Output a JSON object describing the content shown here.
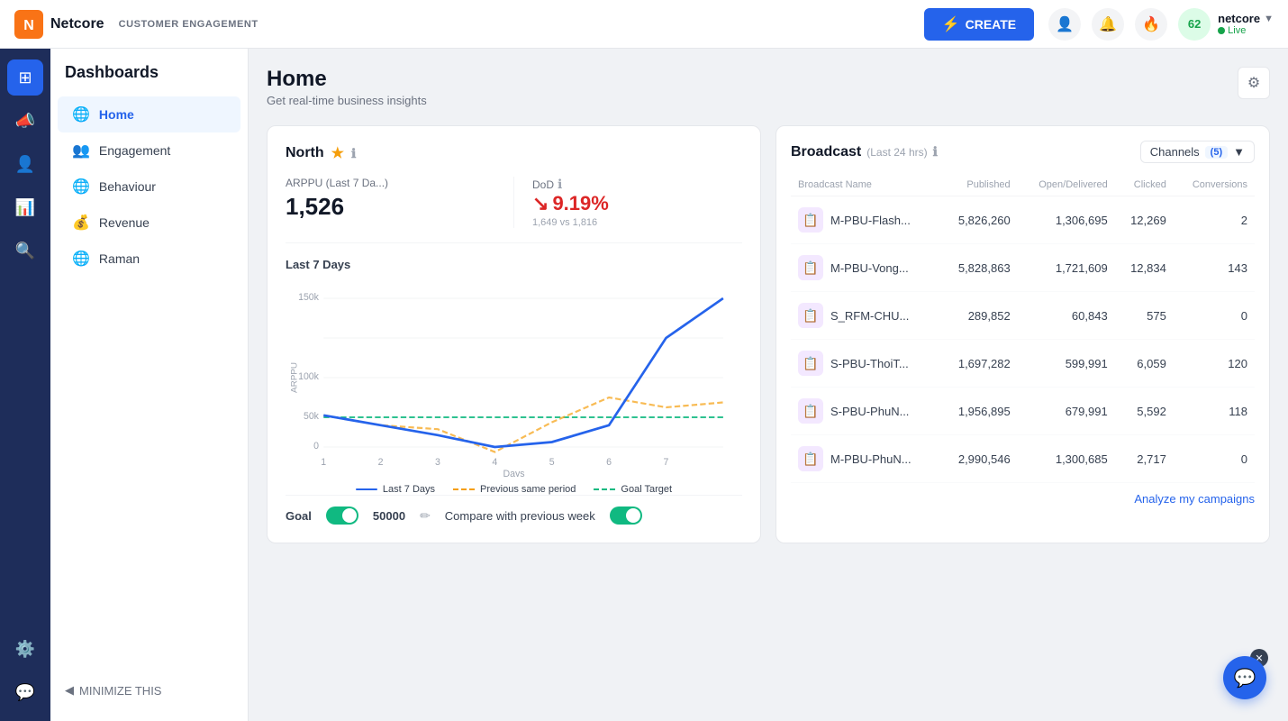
{
  "header": {
    "logo_text": "Netcore",
    "subtitle": "CUSTOMER ENGAGEMENT",
    "create_label": "CREATE",
    "user": {
      "name": "netcore",
      "status": "Live"
    }
  },
  "sidebar": {
    "title": "Dashboards",
    "items": [
      {
        "id": "home",
        "label": "Home",
        "icon": "🌐",
        "active": true
      },
      {
        "id": "engagement",
        "label": "Engagement",
        "icon": "👥",
        "active": false
      },
      {
        "id": "behaviour",
        "label": "Behaviour",
        "icon": "🌐",
        "active": false
      },
      {
        "id": "revenue",
        "label": "Revenue",
        "icon": "💰",
        "active": false
      },
      {
        "id": "raman",
        "label": "Raman",
        "icon": "🌐",
        "active": false
      }
    ],
    "minimize_label": "MINIMIZE THIS"
  },
  "page": {
    "title": "Home",
    "subtitle": "Get real-time business insights"
  },
  "north_card": {
    "title": "North",
    "arppu_label": "ARPPU (Last 7 Da...)",
    "arppu_value": "1,526",
    "dod_label": "DoD",
    "dod_value": "9.19%",
    "dod_comparison": "1,649 vs 1,816",
    "chart_period": "Last 7 Days",
    "y_axis_labels": [
      "0",
      "50k",
      "100k",
      "150k"
    ],
    "x_axis_labels": [
      "1",
      "2",
      "3",
      "4",
      "5",
      "6",
      "7"
    ],
    "x_axis_title": "Days",
    "y_axis_title": "ARPPU",
    "legend": [
      {
        "label": "Last 7 Days",
        "color": "#2563eb",
        "type": "solid"
      },
      {
        "label": "Previous same period",
        "color": "#f59e0b",
        "type": "dashed"
      },
      {
        "label": "Goal Target",
        "color": "#10b981",
        "type": "dashed"
      }
    ],
    "goal_label": "Goal",
    "goal_value": "50000",
    "compare_label": "Compare with previous week"
  },
  "broadcast_card": {
    "title": "Broadcast",
    "subtitle": "(Last 24 hrs)",
    "channels_label": "Channels",
    "channels_count": "(5)",
    "columns": [
      "Broadcast Name",
      "Published",
      "Open/Delivered",
      "Clicked",
      "Conversions"
    ],
    "rows": [
      {
        "name": "M-PBU-Flash...",
        "published": "5,826,260",
        "open": "1,306,695",
        "clicked": "12,269",
        "conversions": "2"
      },
      {
        "name": "M-PBU-Vong...",
        "published": "5,828,863",
        "open": "1,721,609",
        "clicked": "12,834",
        "conversions": "143"
      },
      {
        "name": "S_RFM-CHU...",
        "published": "289,852",
        "open": "60,843",
        "clicked": "575",
        "conversions": "0"
      },
      {
        "name": "S-PBU-ThoiT...",
        "published": "1,697,282",
        "open": "599,991",
        "clicked": "6,059",
        "conversions": "120"
      },
      {
        "name": "S-PBU-PhuN...",
        "published": "1,956,895",
        "open": "679,991",
        "clicked": "5,592",
        "conversions": "118"
      },
      {
        "name": "M-PBU-PhuN...",
        "published": "2,990,546",
        "open": "1,300,685",
        "clicked": "2,717",
        "conversions": "0"
      }
    ],
    "analyze_label": "Analyze my campaigns"
  }
}
